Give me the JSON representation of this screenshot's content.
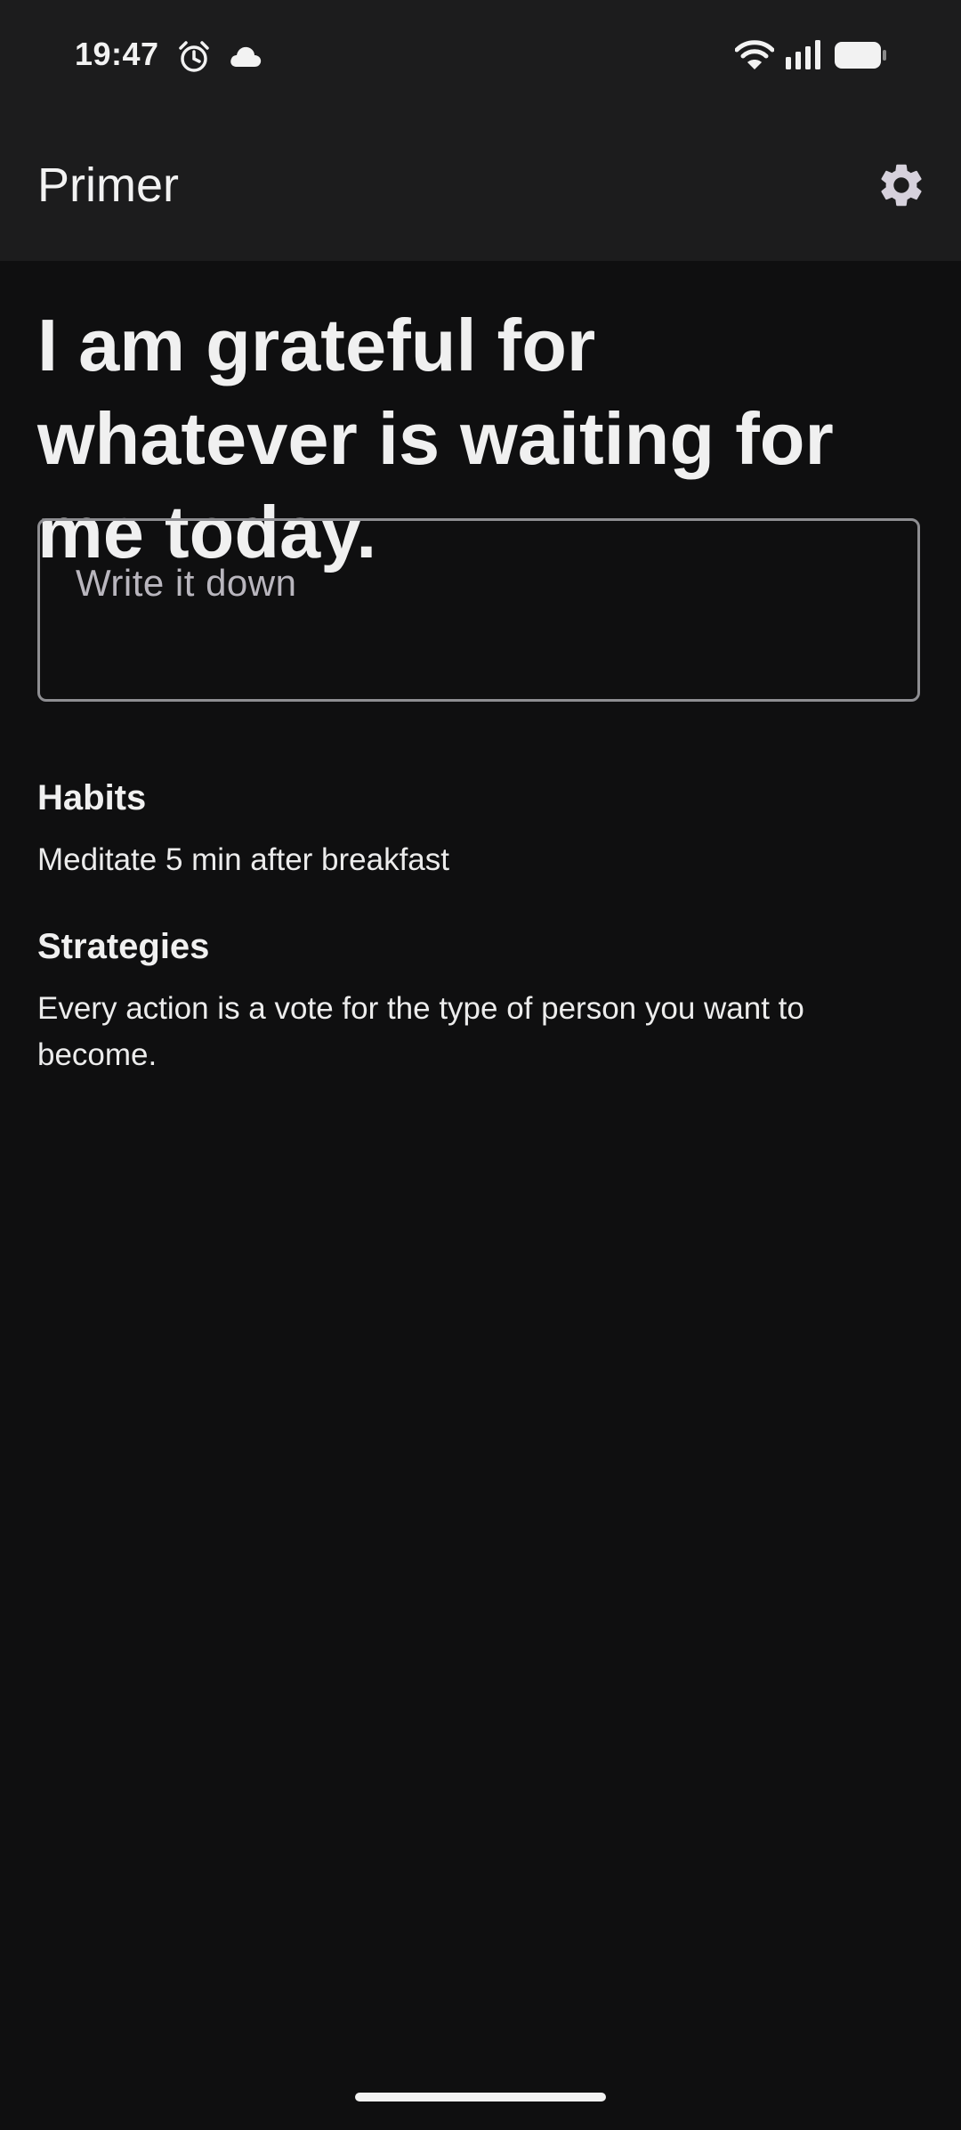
{
  "status_bar": {
    "time": "19:47",
    "icons": [
      "alarm-icon",
      "cloud-icon",
      "wifi-icon",
      "signal-icon",
      "battery-icon"
    ]
  },
  "app_bar": {
    "title": "Primer",
    "settings_icon": "gear-icon"
  },
  "affirmation": {
    "text": "I am grateful for whatever is waiting for me today."
  },
  "journal_input": {
    "placeholder": "Write it down",
    "value": ""
  },
  "habits": {
    "heading": "Habits",
    "text": "Meditate 5 min after breakfast"
  },
  "strategies": {
    "heading": "Strategies",
    "text": "Every action is a vote for the type of person you want to become."
  },
  "colors": {
    "background": "#0f0f10",
    "bar_background": "#1c1c1d",
    "text": "#f0f0f0",
    "input_border": "#8e8e92",
    "gear": "#d6d1dc"
  }
}
